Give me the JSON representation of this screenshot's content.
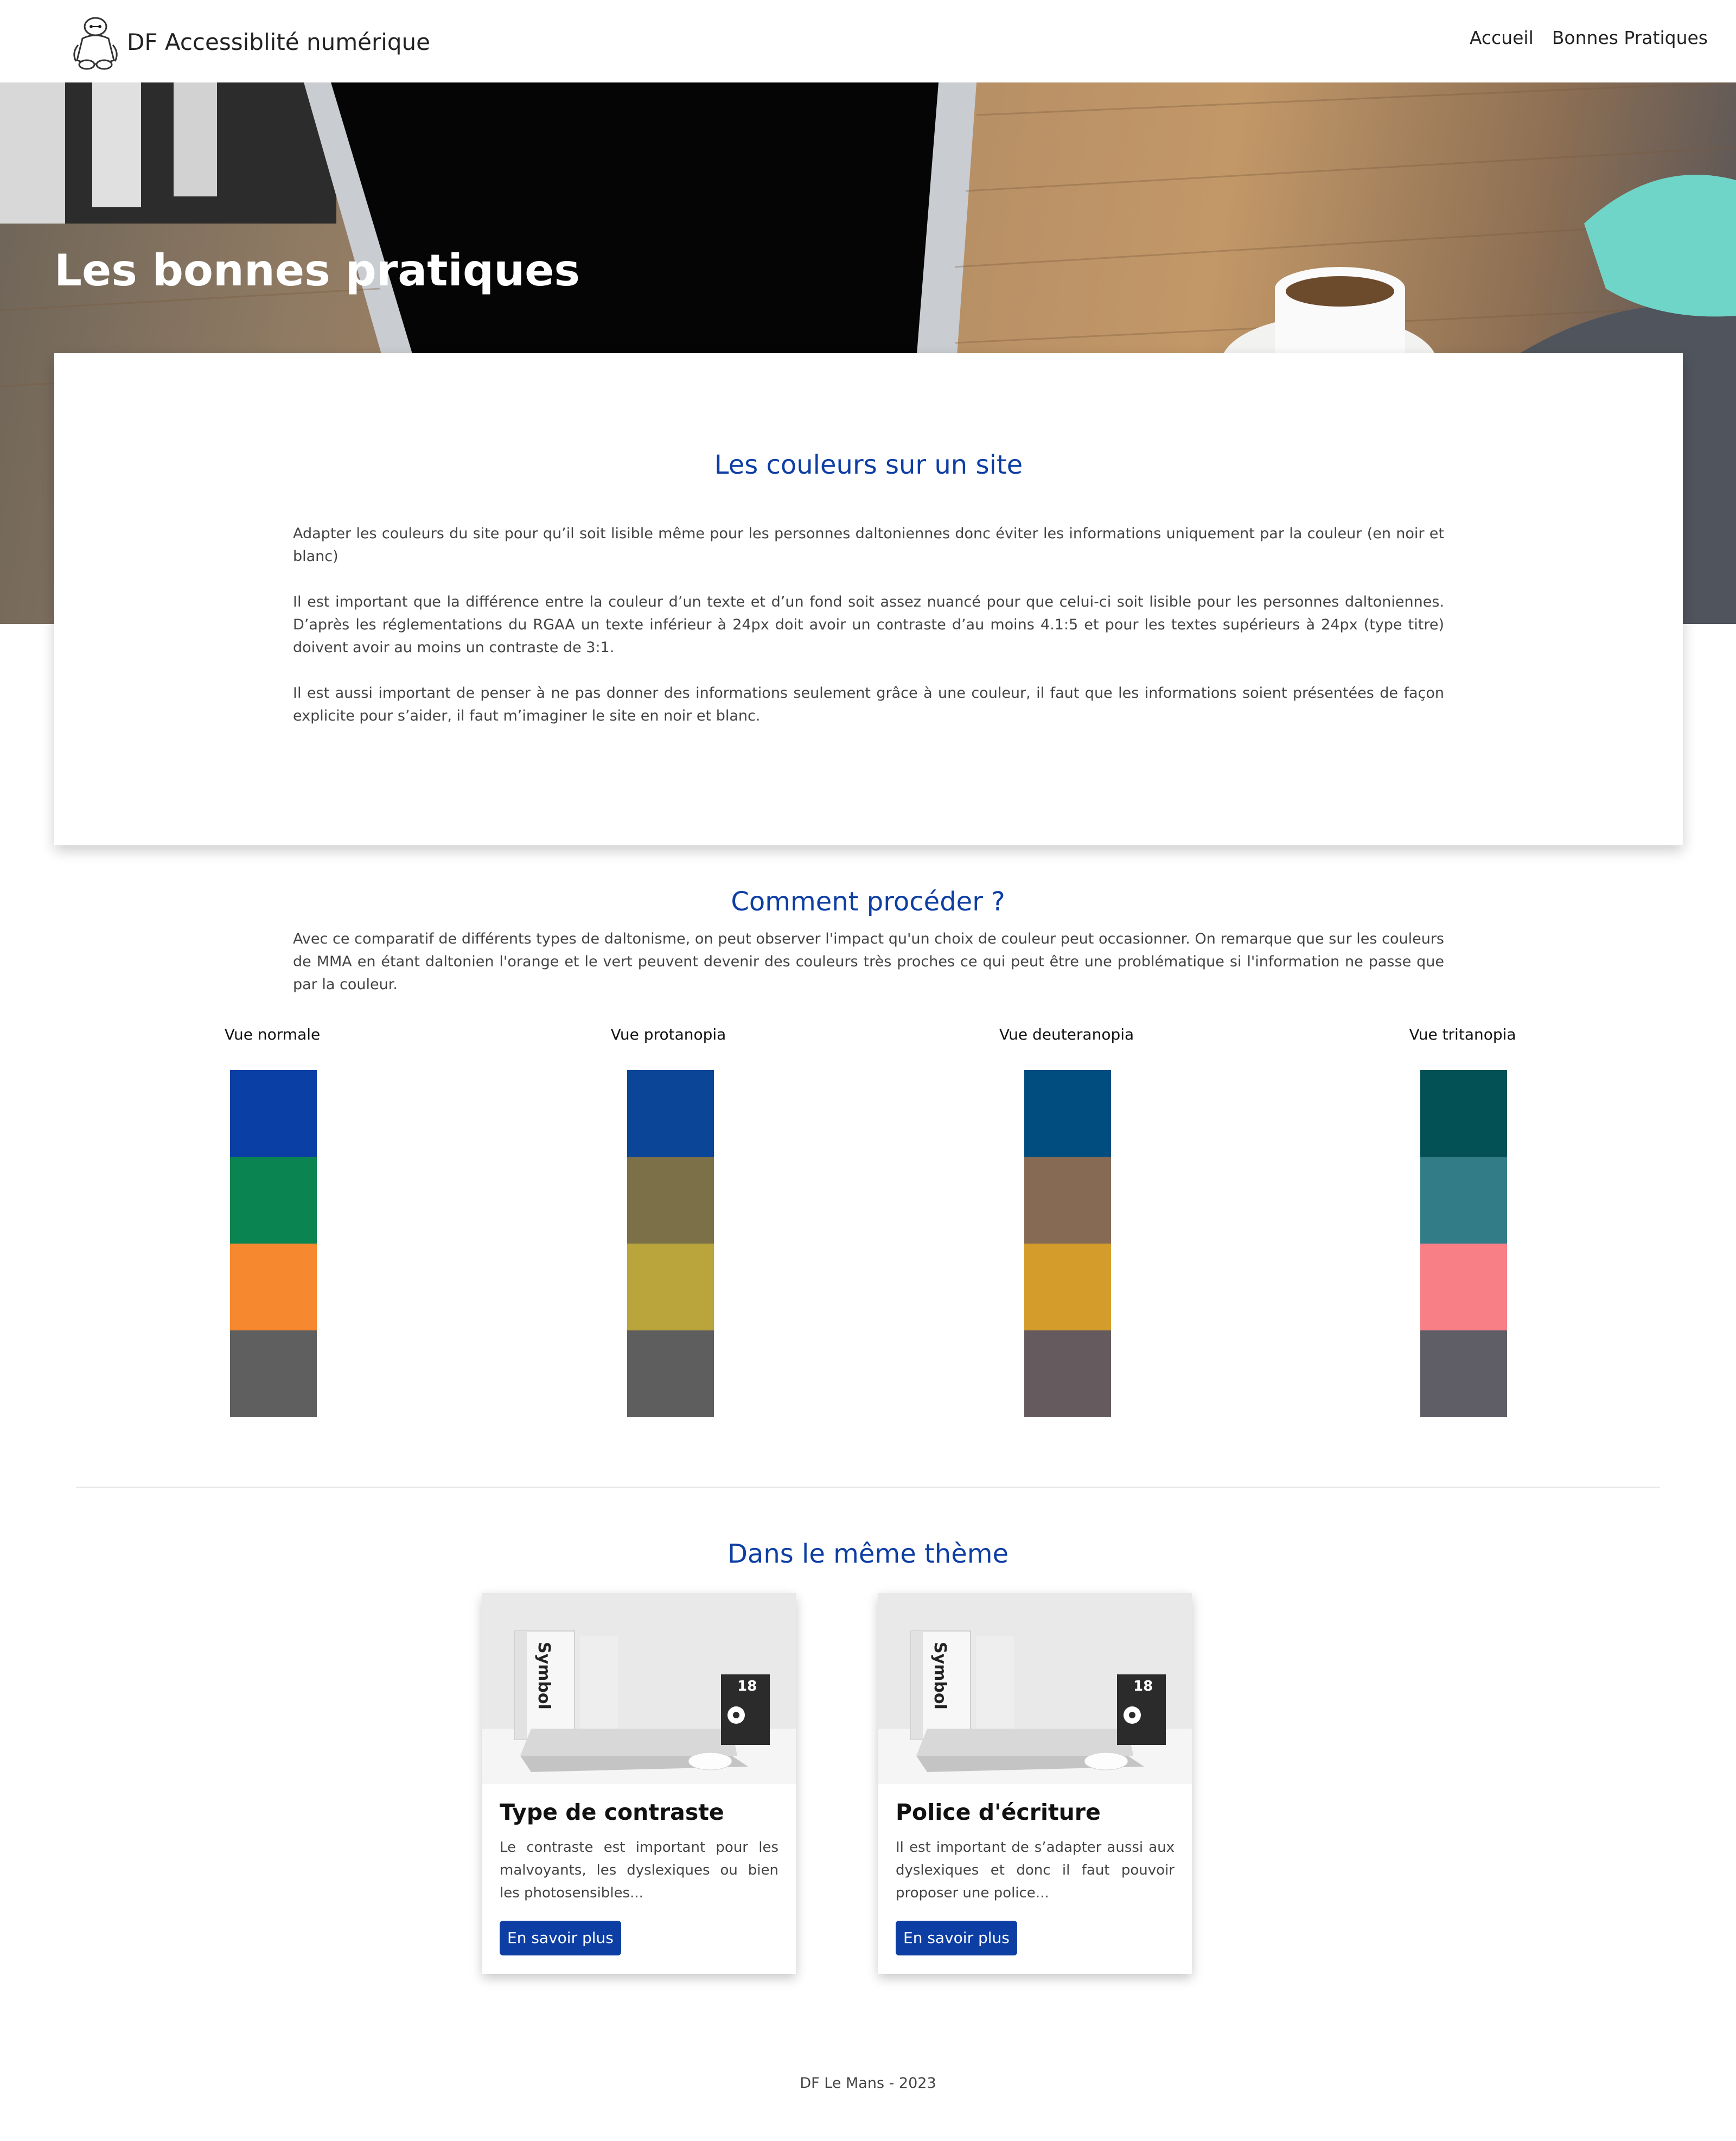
{
  "header": {
    "brand": "DF Accessiblité numérique",
    "nav": [
      "Accueil",
      "Bonnes Pratiques"
    ]
  },
  "hero": {
    "title": "Les bonnes pratiques"
  },
  "colors_section": {
    "title": "Les couleurs sur un site",
    "paragraphs": [
      "Adapter les couleurs du site pour qu’il soit lisible même pour les personnes daltoniennes donc éviter les informations uniquement par la couleur (en noir et blanc)",
      "Il est important que la différence entre la couleur d’un texte et d’un fond soit assez nuancé pour que celui-ci soit lisible pour les personnes daltoniennes. D’après les réglementations du RGAA un texte inférieur à 24px doit avoir un contraste d’au moins 4.1:5 et pour les textes supérieurs à 24px (type titre) doivent avoir au moins un contraste de 3:1.",
      "Il est aussi important de penser à ne pas donner des informations seulement grâce à une couleur, il faut que les informations soient présentées de façon explicite pour s’aider, il faut m’imaginer le site en noir et blanc."
    ]
  },
  "proceder": {
    "title": "Comment procéder ?",
    "text": "Avec ce comparatif de différents types de daltonisme, on peut observer l'impact qu'un choix de couleur peut occasionner. On remarque que sur les couleurs de MMA en étant daltonien l'orange et le vert peuvent devenir des couleurs très proches ce qui peut être une problématique si l'information ne passe que par la couleur."
  },
  "visions": [
    {
      "label": "Vue normale",
      "colors": [
        "#0a3fa6",
        "#0a8450",
        "#f6892f",
        "#5f5f5f"
      ]
    },
    {
      "label": "Vue protanopia",
      "colors": [
        "#0b4597",
        "#7c7049",
        "#b9a53b",
        "#5f5e5f"
      ]
    },
    {
      "label": "Vue deuteranopia",
      "colors": [
        "#024d80",
        "#866a54",
        "#d49d2b",
        "#655b5e"
      ]
    },
    {
      "label": "Vue tritanopia",
      "colors": [
        "#035155",
        "#327c87",
        "#f87f86",
        "#5f5e66"
      ]
    }
  ],
  "related": {
    "title": "Dans le même thème",
    "cards": [
      {
        "title": "Type de contraste",
        "text": "Le contraste est important pour les malvoyants, les dyslexiques ou bien les photosensibles...",
        "button": "En savoir plus",
        "book": "Symbol",
        "badge": "18"
      },
      {
        "title": "Police d'écriture",
        "text": "Il est important de s’adapter aussi aux dyslexiques et donc il faut pouvoir proposer une police...",
        "button": "En savoir plus",
        "book": "Symbol",
        "badge": "18"
      }
    ]
  },
  "footer": {
    "text": "DF Le Mans - 2023"
  },
  "theme": {
    "accent": "#0d3ea3",
    "text": "#444444"
  }
}
